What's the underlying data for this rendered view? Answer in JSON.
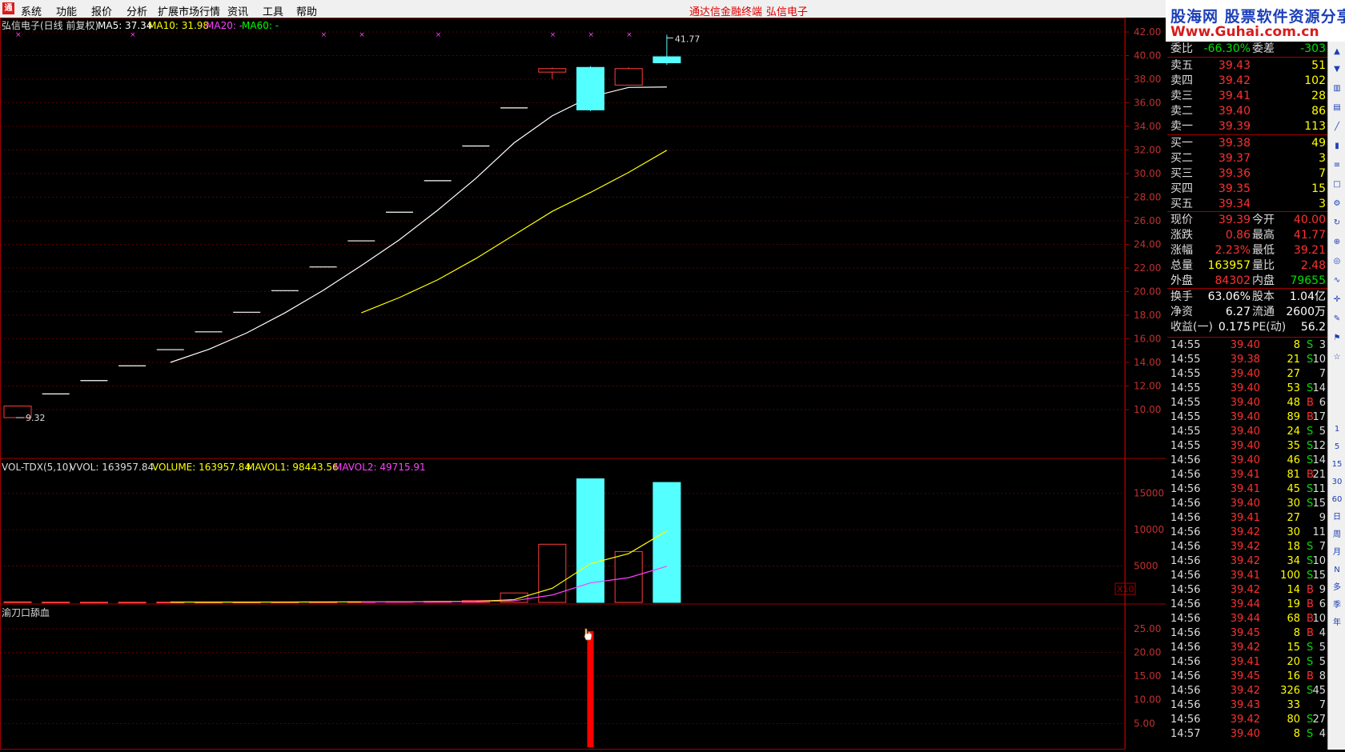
{
  "menu": {
    "items": [
      "系统",
      "功能",
      "报价",
      "分析",
      "扩展市场行情",
      "资讯",
      "工具",
      "帮助"
    ],
    "title_app": "通达信金融终端",
    "title_stock": "弘信电子"
  },
  "watermark": {
    "line1": "股海网 股票软件资源分享",
    "line2": "Www.Guhai.com.cn"
  },
  "price_panel": {
    "header_name": "弘信电子(日线 前复权)",
    "ma5_label": "MA5: 37.34",
    "ma10_label": "MA10: 31.98",
    "ma20_label": "MA20: -",
    "ma60_label": "MA60: -",
    "high_label": "41.77",
    "low_label": "9.32",
    "axis_ticks": [
      "42.00",
      "40.00",
      "38.00",
      "36.00",
      "34.00",
      "32.00",
      "30.00",
      "28.00",
      "26.00",
      "24.00",
      "22.00",
      "20.00",
      "18.00",
      "16.00",
      "14.00",
      "12.00",
      "10.00"
    ]
  },
  "volume_panel": {
    "header_name": "VOL-TDX(5,10)",
    "vvol_label": "VVOL: 163957.84",
    "volume_label": "VOLUME: 163957.84",
    "mavol1_label": "MAVOL1: 98443.56",
    "mavol2_label": "MAVOL2: 49715.91",
    "axis_ticks": [
      "15000",
      "10000",
      "5000"
    ],
    "unit_label": "X10"
  },
  "indicator_panel": {
    "header_name": "渝刀口舔血",
    "axis_ticks": [
      "25.00",
      "20.00",
      "15.00",
      "10.00",
      "5.00"
    ]
  },
  "chart_data": [
    {
      "type": "candlestick",
      "y_axis_range": [
        9.0,
        42.0
      ],
      "candles": [
        {
          "open": 9.32,
          "close": 10.3,
          "high": 10.3,
          "low": 9.32
        },
        {
          "open": 11.33,
          "close": 11.33,
          "high": 11.33,
          "low": 11.33
        },
        {
          "open": 12.46,
          "close": 12.46,
          "high": 12.46,
          "low": 12.46
        },
        {
          "open": 13.71,
          "close": 13.71,
          "high": 13.71,
          "low": 13.71
        },
        {
          "open": 15.08,
          "close": 15.08,
          "high": 15.08,
          "low": 15.08
        },
        {
          "open": 16.59,
          "close": 16.59,
          "high": 16.59,
          "low": 16.59
        },
        {
          "open": 18.25,
          "close": 18.25,
          "high": 18.25,
          "low": 18.25
        },
        {
          "open": 20.08,
          "close": 20.08,
          "high": 20.08,
          "low": 20.08
        },
        {
          "open": 22.09,
          "close": 22.09,
          "high": 22.09,
          "low": 22.09
        },
        {
          "open": 24.3,
          "close": 24.3,
          "high": 24.3,
          "low": 24.3
        },
        {
          "open": 26.73,
          "close": 26.73,
          "high": 26.73,
          "low": 26.73
        },
        {
          "open": 29.4,
          "close": 29.4,
          "high": 29.4,
          "low": 29.4
        },
        {
          "open": 32.34,
          "close": 32.34,
          "high": 32.34,
          "low": 32.34
        },
        {
          "open": 35.57,
          "close": 35.57,
          "high": 35.57,
          "low": 35.57
        },
        {
          "open": 38.6,
          "close": 38.9,
          "high": 39.0,
          "low": 38.0
        },
        {
          "open": 39.0,
          "close": 35.4,
          "high": 39.1,
          "low": 35.3
        },
        {
          "open": 37.5,
          "close": 38.9,
          "high": 39.0,
          "low": 37.5
        },
        {
          "open": 39.9,
          "close": 39.39,
          "high": 41.77,
          "low": 39.21
        }
      ],
      "ma5": [
        null,
        null,
        null,
        null,
        14.0,
        15.1,
        16.5,
        18.2,
        20.1,
        22.2,
        24.4,
        26.9,
        29.6,
        32.6,
        34.9,
        36.5,
        37.3,
        37.34
      ],
      "ma10": [
        null,
        null,
        null,
        null,
        null,
        null,
        null,
        null,
        null,
        18.2,
        19.5,
        21.0,
        22.8,
        24.8,
        26.8,
        28.4,
        30.1,
        31.98
      ]
    },
    {
      "type": "bar",
      "name": "VOL-TDX(5,10)",
      "y_axis_range": [
        0,
        18000
      ],
      "values": [
        80,
        40,
        30,
        30,
        40,
        40,
        50,
        60,
        70,
        90,
        110,
        150,
        250,
        1300,
        8000,
        17000,
        7000,
        16500
      ],
      "rising": [
        true,
        true,
        true,
        true,
        true,
        true,
        true,
        true,
        true,
        true,
        true,
        true,
        true,
        true,
        true,
        false,
        true,
        false
      ],
      "mavol1": [
        null,
        null,
        null,
        null,
        48,
        40,
        42,
        50,
        62,
        74,
        86,
        108,
        146,
        380,
        1942,
        5336,
        6710,
        9844
      ],
      "mavol2": [
        null,
        null,
        null,
        null,
        null,
        null,
        null,
        null,
        null,
        56,
        63,
        77,
        102,
        226,
        1020,
        2690,
        3400,
        4972
      ]
    },
    {
      "type": "bar",
      "name": "渝刀口舔血",
      "y_axis_range": [
        0,
        27
      ],
      "values": [
        0,
        0,
        0,
        0,
        0,
        0,
        0,
        0,
        0,
        0,
        0,
        0,
        0,
        0,
        0,
        24.5,
        0,
        0
      ]
    }
  ],
  "quote": {
    "weibi_label": "委比",
    "weibi": "-66.30%",
    "weicha_label": "委差",
    "weicha": "-303",
    "asks": [
      {
        "label": "卖五",
        "price": "39.43",
        "vol": "51"
      },
      {
        "label": "卖四",
        "price": "39.42",
        "vol": "102"
      },
      {
        "label": "卖三",
        "price": "39.41",
        "vol": "28"
      },
      {
        "label": "卖二",
        "price": "39.40",
        "vol": "86"
      },
      {
        "label": "卖一",
        "price": "39.39",
        "vol": "113"
      }
    ],
    "bids": [
      {
        "label": "买一",
        "price": "39.38",
        "vol": "49"
      },
      {
        "label": "买二",
        "price": "39.37",
        "vol": "3"
      },
      {
        "label": "买三",
        "price": "39.36",
        "vol": "7"
      },
      {
        "label": "买四",
        "price": "39.35",
        "vol": "15"
      },
      {
        "label": "买五",
        "price": "39.34",
        "vol": "3"
      }
    ],
    "stats": [
      {
        "l1": "现价",
        "v1": "39.39",
        "c1": "#ff3030",
        "l2": "今开",
        "v2": "40.00",
        "c2": "#ff3030"
      },
      {
        "l1": "涨跌",
        "v1": "0.86",
        "c1": "#ff3030",
        "l2": "最高",
        "v2": "41.77",
        "c2": "#ff3030"
      },
      {
        "l1": "涨幅",
        "v1": "2.23%",
        "c1": "#ff3030",
        "l2": "最低",
        "v2": "39.21",
        "c2": "#ff3030"
      },
      {
        "l1": "总量",
        "v1": "163957",
        "c1": "#ffff00",
        "l2": "量比",
        "v2": "2.48",
        "c2": "#ff3030"
      },
      {
        "l1": "外盘",
        "v1": "84302",
        "c1": "#ff3030",
        "l2": "内盘",
        "v2": "79655",
        "c2": "#00e000"
      }
    ],
    "stats2": [
      {
        "l1": "换手",
        "v1": "63.06%",
        "l2": "股本",
        "v2": "1.04亿"
      },
      {
        "l1": "净资",
        "v1": "6.27",
        "l2": "流通",
        "v2": "2600万"
      },
      {
        "l1": "收益(一)",
        "v1": "0.175",
        "l2": "PE(动)",
        "v2": "56.2"
      }
    ]
  },
  "ticks": [
    {
      "time": "14:55",
      "price": "39.40",
      "vol": "8",
      "side": "S",
      "cnt": "3"
    },
    {
      "time": "14:55",
      "price": "39.38",
      "vol": "21",
      "side": "S",
      "cnt": "10"
    },
    {
      "time": "14:55",
      "price": "39.40",
      "vol": "27",
      "side": "",
      "cnt": "7"
    },
    {
      "time": "14:55",
      "price": "39.40",
      "vol": "53",
      "side": "S",
      "cnt": "14"
    },
    {
      "time": "14:55",
      "price": "39.40",
      "vol": "48",
      "side": "B",
      "cnt": "6"
    },
    {
      "time": "14:55",
      "price": "39.40",
      "vol": "89",
      "side": "B",
      "cnt": "17"
    },
    {
      "time": "14:55",
      "price": "39.40",
      "vol": "24",
      "side": "S",
      "cnt": "5"
    },
    {
      "time": "14:55",
      "price": "39.40",
      "vol": "35",
      "side": "S",
      "cnt": "12"
    },
    {
      "time": "14:56",
      "price": "39.40",
      "vol": "46",
      "side": "S",
      "cnt": "14"
    },
    {
      "time": "14:56",
      "price": "39.41",
      "vol": "81",
      "side": "B",
      "cnt": "21"
    },
    {
      "time": "14:56",
      "price": "39.41",
      "vol": "45",
      "side": "S",
      "cnt": "11"
    },
    {
      "time": "14:56",
      "price": "39.40",
      "vol": "30",
      "side": "S",
      "cnt": "15"
    },
    {
      "time": "14:56",
      "price": "39.41",
      "vol": "27",
      "side": "",
      "cnt": "9"
    },
    {
      "time": "14:56",
      "price": "39.42",
      "vol": "30",
      "side": "",
      "cnt": "11"
    },
    {
      "time": "14:56",
      "price": "39.42",
      "vol": "18",
      "side": "S",
      "cnt": "7"
    },
    {
      "time": "14:56",
      "price": "39.42",
      "vol": "34",
      "side": "S",
      "cnt": "10"
    },
    {
      "time": "14:56",
      "price": "39.41",
      "vol": "100",
      "side": "S",
      "cnt": "15"
    },
    {
      "time": "14:56",
      "price": "39.42",
      "vol": "14",
      "side": "B",
      "cnt": "9"
    },
    {
      "time": "14:56",
      "price": "39.44",
      "vol": "19",
      "side": "B",
      "cnt": "6"
    },
    {
      "time": "14:56",
      "price": "39.44",
      "vol": "68",
      "side": "B",
      "cnt": "10"
    },
    {
      "time": "14:56",
      "price": "39.45",
      "vol": "8",
      "side": "B",
      "cnt": "4"
    },
    {
      "time": "14:56",
      "price": "39.42",
      "vol": "15",
      "side": "S",
      "cnt": "5"
    },
    {
      "time": "14:56",
      "price": "39.41",
      "vol": "20",
      "side": "S",
      "cnt": "5"
    },
    {
      "time": "14:56",
      "price": "39.45",
      "vol": "16",
      "side": "B",
      "cnt": "8"
    },
    {
      "time": "14:56",
      "price": "39.42",
      "vol": "326",
      "side": "S",
      "cnt": "45"
    },
    {
      "time": "14:56",
      "price": "39.43",
      "vol": "33",
      "side": "",
      "cnt": "7"
    },
    {
      "time": "14:56",
      "price": "39.42",
      "vol": "80",
      "side": "S",
      "cnt": "27"
    },
    {
      "time": "14:57",
      "price": "39.40",
      "vol": "8",
      "side": "S",
      "cnt": "4"
    }
  ],
  "toolbar_labels": [
    "1",
    "5",
    "15",
    "30",
    "60",
    "日",
    "周",
    "月",
    "N",
    "多",
    "季",
    "年"
  ],
  "colors": {
    "up": "#ff3c3c",
    "down": "#54ffff",
    "ma5": "#ffffff",
    "ma10": "#ffff00",
    "mavol2": "#ff40ff",
    "grid": "#7a0000",
    "indicator": "#ff0000"
  }
}
